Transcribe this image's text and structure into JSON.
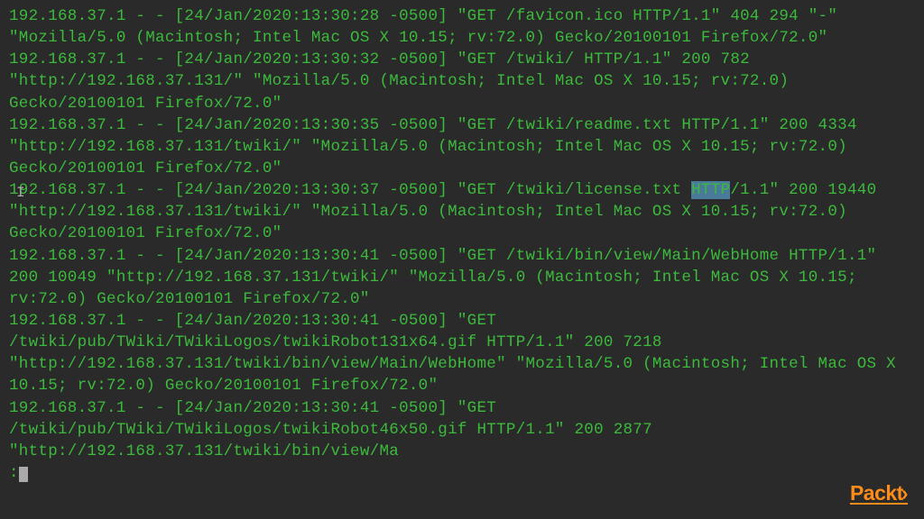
{
  "log": {
    "pre": "192.168.37.1 - - [24/Jan/2020:13:30:28 -0500] \"GET /favicon.ico HTTP/1.1\" 404 294 \"-\" \"Mozilla/5.0 (Macintosh; Intel Mac OS X 10.15; rv:72.0) Gecko/20100101 Firefox/72.0\"\n192.168.37.1 - - [24/Jan/2020:13:30:32 -0500] \"GET /twiki/ HTTP/1.1\" 200 782 \"http://192.168.37.131/\" \"Mozilla/5.0 (Macintosh; Intel Mac OS X 10.15; rv:72.0) Gecko/20100101 Firefox/72.0\"\n192.168.37.1 - - [24/Jan/2020:13:30:35 -0500] \"GET /twiki/readme.txt HTTP/1.1\" 200 4334 \"http://192.168.37.131/twiki/\" \"Mozilla/5.0 (Macintosh; Intel Mac OS X 10.15; rv:72.0) Gecko/20100101 Firefox/72.0\"\n192.168.37.1 - - [24/Jan/2020:13:30:37 -0500] \"GET /twiki/license.txt ",
    "highlight": "HTTP",
    "post": "/1.1\" 200 19440 \"http://192.168.37.131/twiki/\" \"Mozilla/5.0 (Macintosh; Intel Mac OS X 10.15; rv:72.0) Gecko/20100101 Firefox/72.0\"\n192.168.37.1 - - [24/Jan/2020:13:30:41 -0500] \"GET /twiki/bin/view/Main/WebHome HTTP/1.1\" 200 10049 \"http://192.168.37.131/twiki/\" \"Mozilla/5.0 (Macintosh; Intel Mac OS X 10.15; rv:72.0) Gecko/20100101 Firefox/72.0\"\n192.168.37.1 - - [24/Jan/2020:13:30:41 -0500] \"GET /twiki/pub/TWiki/TWikiLogos/twikiRobot131x64.gif HTTP/1.1\" 200 7218 \"http://192.168.37.131/twiki/bin/view/Main/WebHome\" \"Mozilla/5.0 (Macintosh; Intel Mac OS X 10.15; rv:72.0) Gecko/20100101 Firefox/72.0\"\n192.168.37.1 - - [24/Jan/2020:13:30:41 -0500] \"GET /twiki/pub/TWiki/TWikiLogos/twikiRobot46x50.gif HTTP/1.1\" 200 2877 \"http://192.168.37.131/twiki/bin/view/Ma"
  },
  "prompt": ":",
  "branding": {
    "name": "Packt",
    "chev": "›"
  },
  "cursor_icon": "I"
}
